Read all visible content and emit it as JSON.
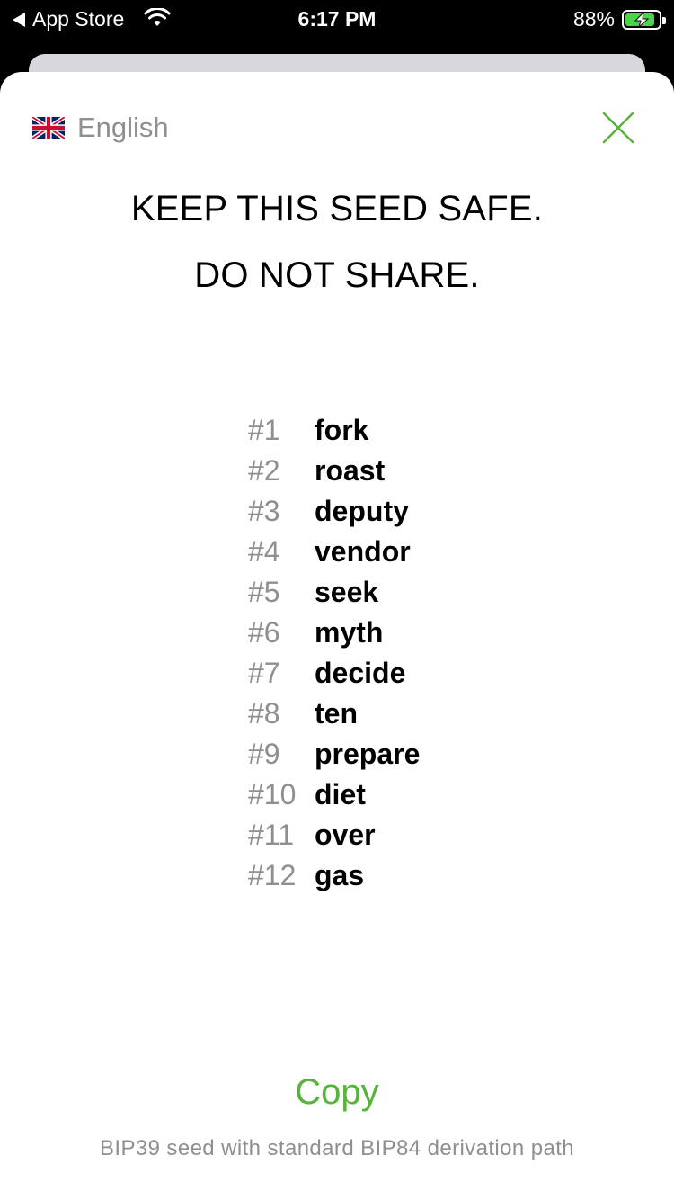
{
  "status_bar": {
    "back_label": "App Store",
    "time": "6:17 PM",
    "battery_percent": "88%",
    "battery_level": 0.88,
    "battery_color": "#4bd34a"
  },
  "language": {
    "flag_icon": "uk-flag-icon",
    "label": "English"
  },
  "close_icon": "close-icon",
  "accent_color": "#58b33b",
  "warning": {
    "line1": "KEEP THIS SEED SAFE.",
    "line2": "DO NOT SHARE."
  },
  "seed_words": [
    {
      "num": "#1",
      "word": "fork"
    },
    {
      "num": "#2",
      "word": "roast"
    },
    {
      "num": "#3",
      "word": "deputy"
    },
    {
      "num": "#4",
      "word": "vendor"
    },
    {
      "num": "#5",
      "word": "seek"
    },
    {
      "num": "#6",
      "word": "myth"
    },
    {
      "num": "#7",
      "word": "decide"
    },
    {
      "num": "#8",
      "word": "ten"
    },
    {
      "num": "#9",
      "word": "prepare"
    },
    {
      "num": "#10",
      "word": "diet"
    },
    {
      "num": "#11",
      "word": "over"
    },
    {
      "num": "#12",
      "word": "gas"
    }
  ],
  "copy_label": "Copy",
  "footnote": "BIP39 seed with standard BIP84 derivation path"
}
